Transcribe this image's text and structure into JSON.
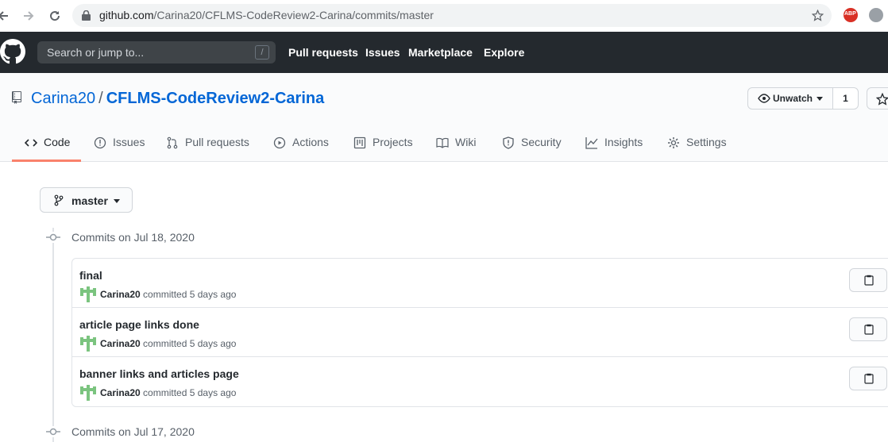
{
  "browser": {
    "url_host": "github.com",
    "url_path": "/Carina20/CFLMS-CodeReview2-Carina/commits/master",
    "extension_label": "ABP"
  },
  "header": {
    "search_placeholder": "Search or jump to...",
    "search_shortcut": "/",
    "nav": [
      "Pull requests",
      "Issues",
      "Marketplace",
      "Explore"
    ]
  },
  "repo": {
    "owner": "Carina20",
    "separator": "/",
    "name": "CFLMS-CodeReview2-Carina",
    "watch_label": "Unwatch",
    "watch_count": "1"
  },
  "tabs": [
    {
      "label": "Code",
      "icon": "code-icon",
      "selected": true
    },
    {
      "label": "Issues",
      "icon": "issue-icon"
    },
    {
      "label": "Pull requests",
      "icon": "pull-request-icon"
    },
    {
      "label": "Actions",
      "icon": "play-icon"
    },
    {
      "label": "Projects",
      "icon": "project-icon"
    },
    {
      "label": "Wiki",
      "icon": "book-icon"
    },
    {
      "label": "Security",
      "icon": "shield-icon"
    },
    {
      "label": "Insights",
      "icon": "graph-icon"
    },
    {
      "label": "Settings",
      "icon": "gear-icon"
    }
  ],
  "branch": {
    "label": "master"
  },
  "groups": [
    {
      "header": "Commits on Jul 18, 2020",
      "commits": [
        {
          "title": "final",
          "author": "Carina20",
          "meta": " committed 5 days ago"
        },
        {
          "title": "article page links done",
          "author": "Carina20",
          "meta": " committed 5 days ago"
        },
        {
          "title": "banner links and articles page",
          "author": "Carina20",
          "meta": " committed 5 days ago"
        }
      ]
    },
    {
      "header": "Commits on Jul 17, 2020",
      "commits": []
    }
  ],
  "colors": {
    "accent": "#0366d6",
    "header_bg": "#24292e",
    "tab_underline": "#f9826c",
    "avatar": "#7bc47f"
  }
}
